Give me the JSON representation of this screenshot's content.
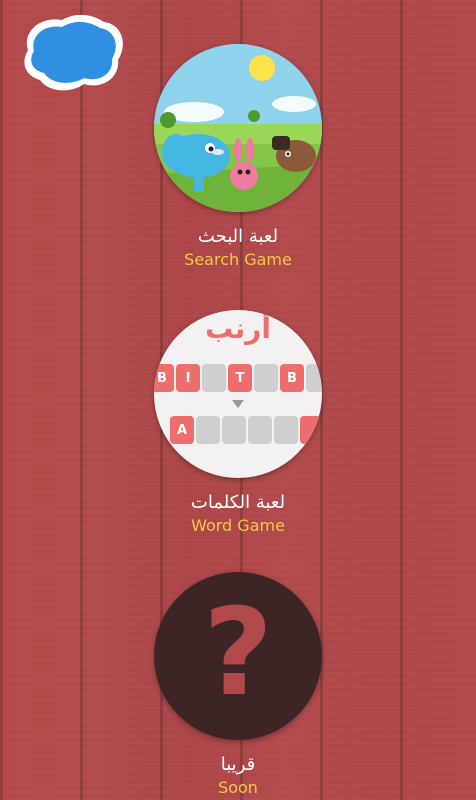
{
  "colors": {
    "background": "#b04a4c",
    "label_primary": "#ffffff",
    "label_secondary": "#f2c84b",
    "back_button": "#2f8fe0",
    "soon_circle": "#3d2526"
  },
  "back_button": {
    "icon": "blue-blob-back-icon"
  },
  "menu": [
    {
      "title_ar": "لعبة البحث",
      "title_en": "Search Game",
      "icon": "animals-meadow-illustration"
    },
    {
      "title_ar": "لعبة الكلمات",
      "title_en": "Word Game",
      "icon": "word-tiles-preview",
      "preview": {
        "word": "أرنب",
        "top_letters": [
          "B",
          "I",
          "",
          "T",
          "",
          "B"
        ],
        "bottom_letters": [
          "A",
          "",
          "",
          "",
          "",
          ""
        ]
      }
    },
    {
      "title_ar": "قريبا",
      "title_en": "Soon",
      "icon": "question-mark-icon",
      "symbol": "?"
    }
  ]
}
